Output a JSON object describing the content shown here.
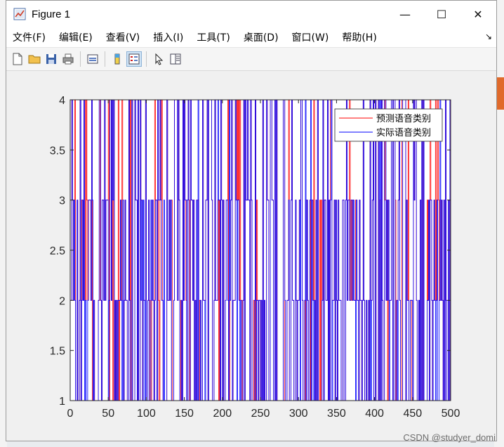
{
  "window": {
    "title": "Figure 1",
    "controls": {
      "minimize": "—",
      "maximize": "☐",
      "close": "✕"
    }
  },
  "menubar": {
    "items": [
      "文件(F)",
      "编辑(E)",
      "查看(V)",
      "插入(I)",
      "工具(T)",
      "桌面(D)",
      "窗口(W)",
      "帮助(H)"
    ]
  },
  "toolbar": {
    "buttons": [
      "new-figure-icon",
      "open-file-icon",
      "save-icon",
      "print-icon",
      "link-plot-icon",
      "insert-colorbar-icon",
      "insert-legend-icon",
      "pointer-icon",
      "property-inspector-icon"
    ]
  },
  "colors": {
    "predicted": "#ff0000",
    "actual": "#0000ff",
    "axes": "#262626",
    "plot_bg": "#ffffff"
  },
  "chart_data": {
    "type": "line",
    "title": "",
    "xlabel": "",
    "ylabel": "",
    "xlim": [
      0,
      500
    ],
    "ylim": [
      1,
      4
    ],
    "xticks": [
      "0",
      "50",
      "100",
      "150",
      "200",
      "250",
      "300",
      "350",
      "400",
      "450",
      "500"
    ],
    "yticks": [
      "1",
      "1.5",
      "2",
      "2.5",
      "3",
      "3.5",
      "4"
    ],
    "grid": false,
    "legend_position": "top-right",
    "series": [
      {
        "name": "预测语音类别",
        "color": "#ff0000",
        "style": "step",
        "x_start": 1,
        "x_end": 500,
        "values_domain": [
          1,
          2,
          3,
          4
        ]
      },
      {
        "name": "实际语音类别",
        "color": "#0000ff",
        "style": "step",
        "x_start": 1,
        "x_end": 500,
        "values_domain": [
          1,
          2,
          3,
          4
        ]
      }
    ]
  },
  "watermark": "CSDN @studyer_domi"
}
